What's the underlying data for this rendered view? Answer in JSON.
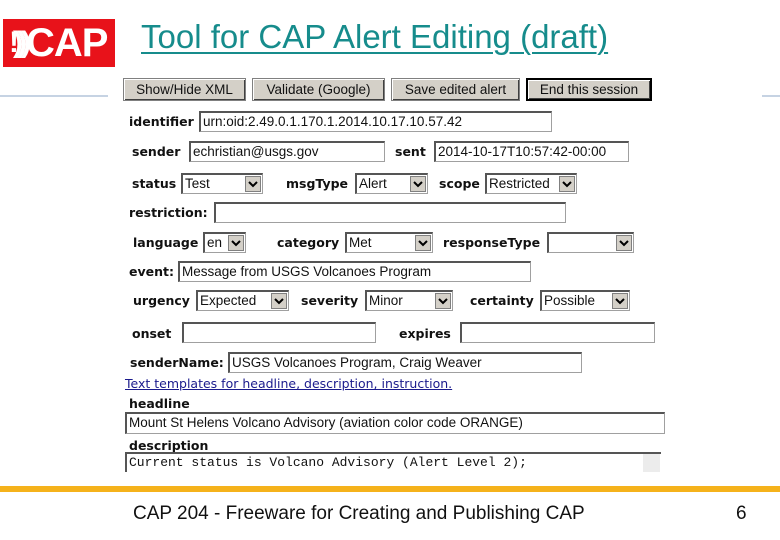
{
  "slide": {
    "logo_text": "CAP",
    "title": "Tool for CAP Alert Editing (draft)",
    "footer_text": "CAP 204 - Freeware for Creating and Publishing CAP",
    "page_number": "6"
  },
  "colors": {
    "logo_red": "#e8121a",
    "title_teal": "#168c8c",
    "footer_bar_orange": "#f5b21b",
    "button_gray": "#d4d0c8"
  },
  "toolbar": {
    "show_hide_xml": "Show/Hide XML",
    "validate": "Validate (Google)",
    "save": "Save edited alert",
    "end_session": "End this session"
  },
  "form": {
    "identifier": {
      "label": "identifier",
      "value": "urn:oid:2.49.0.1.170.1.2014.10.17.10.57.42"
    },
    "sender": {
      "label": "sender",
      "value": "echristian@usgs.gov"
    },
    "sent": {
      "label": "sent",
      "value": "2014-10-17T10:57:42-00:00"
    },
    "status": {
      "label": "status",
      "value": "Test"
    },
    "msgType": {
      "label": "msgType",
      "value": "Alert"
    },
    "scope": {
      "label": "scope",
      "value": "Restricted"
    },
    "restriction": {
      "label": "restriction:",
      "value": ""
    },
    "language": {
      "label": "language",
      "value": "en"
    },
    "category": {
      "label": "category",
      "value": "Met"
    },
    "responseType": {
      "label": "responseType",
      "value": ""
    },
    "event": {
      "label": "event:",
      "value": "Message from USGS Volcanoes Program"
    },
    "urgency": {
      "label": "urgency",
      "value": "Expected"
    },
    "severity": {
      "label": "severity",
      "value": "Minor"
    },
    "certainty": {
      "label": "certainty",
      "value": "Possible"
    },
    "onset": {
      "label": "onset",
      "value": ""
    },
    "expires": {
      "label": "expires",
      "value": ""
    },
    "senderName": {
      "label": "senderName:",
      "value": "USGS Volcanoes Program, Craig Weaver"
    },
    "templates_link": "Text templates for headline, description, instruction.",
    "headline": {
      "label": "headline",
      "value": "Mount St Helens Volcano Advisory (aviation color code ORANGE)"
    },
    "description": {
      "label": "description",
      "value": "Current status is Volcano Advisory (Alert Level 2);"
    }
  }
}
